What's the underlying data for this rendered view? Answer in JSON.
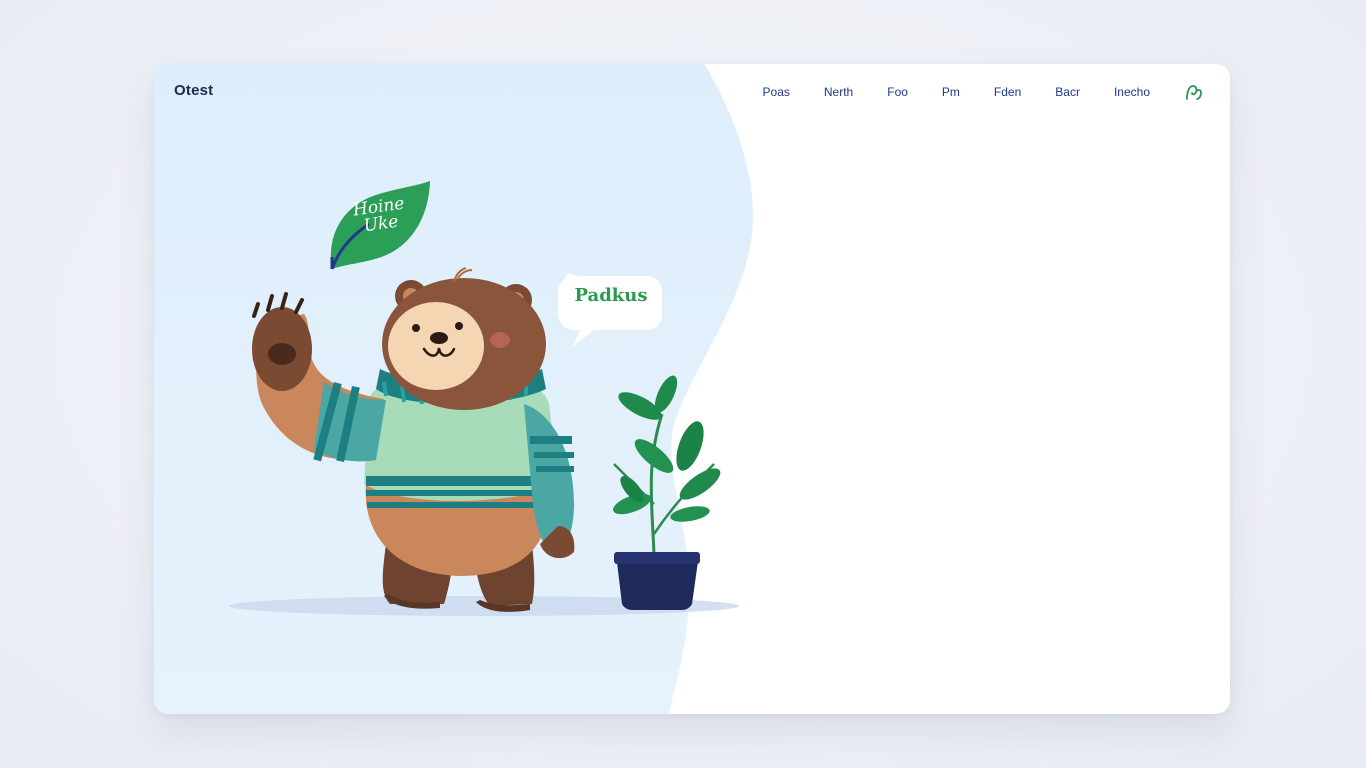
{
  "header": {
    "brand": "Otest",
    "nav": [
      {
        "label": "Poas"
      },
      {
        "label": "Nerth"
      },
      {
        "label": "Foo"
      },
      {
        "label": "Pm"
      },
      {
        "label": "Fden"
      },
      {
        "label": "Bacr"
      },
      {
        "label": "Inecho"
      }
    ],
    "profile_icon": "user-outline-icon"
  },
  "hero": {
    "leaf_label": "Hoine Uke",
    "speech_bubble": "Padkus"
  },
  "colors": {
    "hero_background": "#dcecfa",
    "nav_text": "#1d3a8a",
    "brand_text": "#1c2b4a",
    "accent_green": "#2a9a4f",
    "leaf_green": "#2b9e57",
    "pot_navy": "#1f2a5c"
  }
}
